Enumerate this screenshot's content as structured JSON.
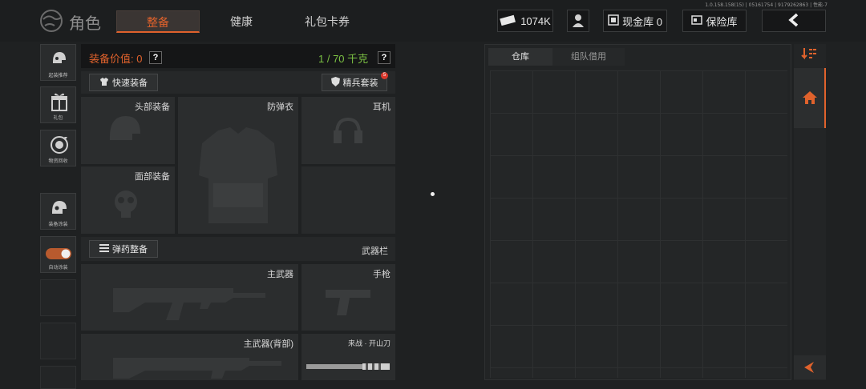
{
  "version": "1.0.158.158(15) | 05161754 | 9179262863 | 性能-7",
  "header": {
    "title": "角色",
    "tabs": [
      "整备",
      "健康",
      "礼包卡券"
    ],
    "currency": "1074K",
    "cash_vault": "现金库 0",
    "safe_box": "保险库"
  },
  "sidebar": {
    "items": [
      "起装推荐",
      "礼包",
      "物资回收",
      "装备涂装",
      "自动涂装"
    ]
  },
  "equipment": {
    "value_label": "装备价值: 0",
    "weight_label": "1 / 70 千克",
    "quick_equip": "快速装备",
    "elite_set": "精兵套装",
    "elite_badge": "5",
    "ammo_prep": "弹药整备",
    "weapon_bar": "武器栏",
    "slots": {
      "head": "头部装备",
      "armor": "防弹衣",
      "headset": "耳机",
      "face": "面部装备",
      "primary": "主武器",
      "pistol": "手枪",
      "primary_back": "主武器(背部)",
      "melee": "来战 · 开山刀"
    }
  },
  "warehouse": {
    "tabs": [
      "仓库",
      "组队借用"
    ]
  },
  "colors": {
    "accent": "#e0622c",
    "weight_green": "#7bc043",
    "badge_red": "#d9382c"
  }
}
